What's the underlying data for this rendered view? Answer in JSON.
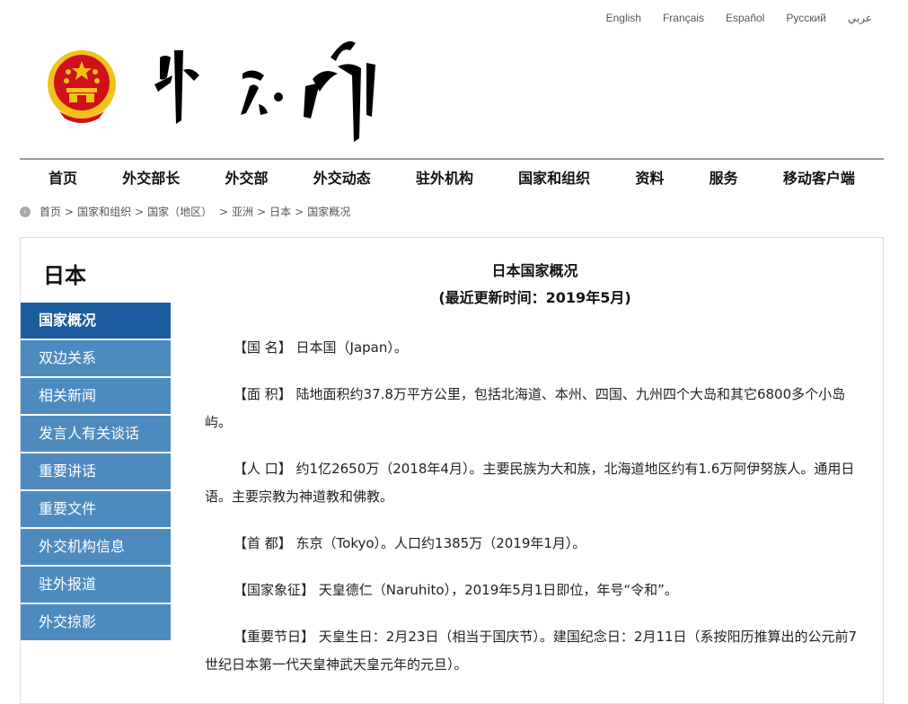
{
  "lang_links": [
    "English",
    "Français",
    "Español",
    "Русский",
    "عربي"
  ],
  "logo_text": "外交部",
  "nav": [
    "首页",
    "外交部长",
    "外交部",
    "外交动态",
    "驻外机构",
    "国家和组织",
    "资料",
    "服务",
    "移动客户端"
  ],
  "breadcrumb": [
    "首页",
    "国家和组织",
    "国家（地区）",
    "亚洲",
    "日本",
    "国家概况"
  ],
  "country_name": "日本",
  "sidebar": [
    "国家概况",
    "双边关系",
    "相关新闻",
    "发言人有关谈话",
    "重要讲话",
    "重要文件",
    "外交机构信息",
    "驻外报道",
    "外交掠影"
  ],
  "article": {
    "title": "日本国家概况",
    "subtitle": "(最近更新时间：2019年5月)",
    "paragraphs": [
      "【国 名】 日本国（Japan）。",
      "【面 积】 陆地面积约37.8万平方公里，包括北海道、本州、四国、九州四个大岛和其它6800多个小岛屿。",
      "【人 口】 约1亿2650万（2018年4月）。主要民族为大和族，北海道地区约有1.6万阿伊努族人。通用日语。主要宗教为神道教和佛教。",
      "【首 都】 东京（Tokyo）。人口约1385万（2019年1月）。",
      "【国家象征】 天皇德仁（Naruhito），2019年5月1日即位，年号“令和”。",
      "【重要节日】 天皇生日：2月23日（相当于国庆节）。建国纪念日：2月11日（系按阳历推算出的公元前7世纪日本第一代天皇神武天皇元年的元旦）。"
    ]
  },
  "colors": {
    "sidebar": "#4d8bbf",
    "sidebar_active": "#1a5c9e",
    "emblem_red": "#d0111b",
    "emblem_gold": "#f2c21b"
  }
}
